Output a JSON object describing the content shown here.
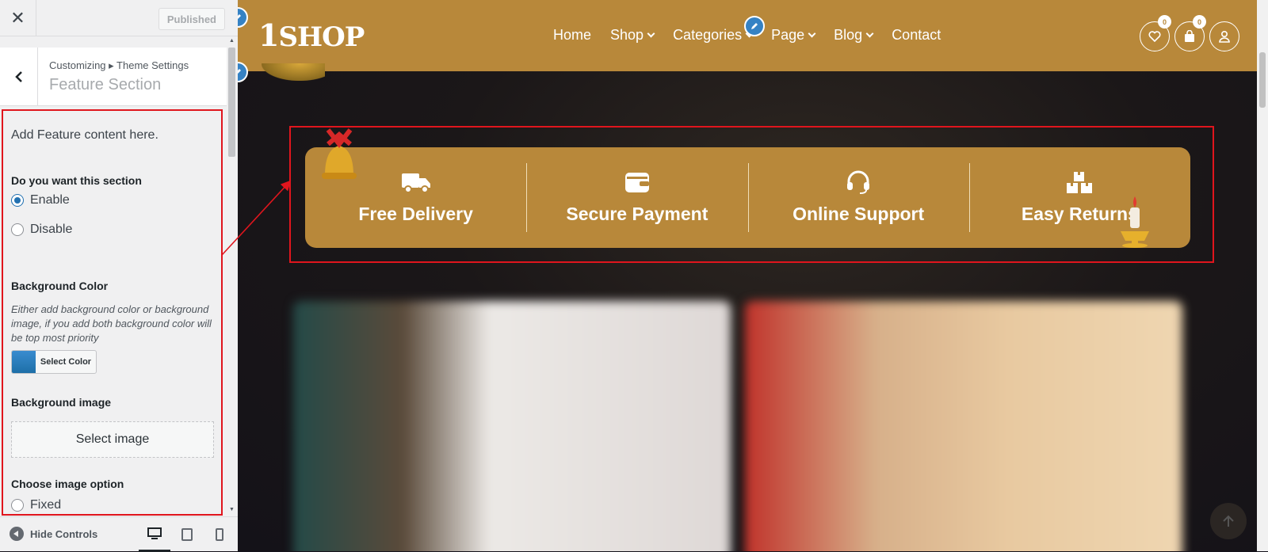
{
  "customizer": {
    "close_label": "✕",
    "publish_label": "Published",
    "breadcrumb": "Customizing ▸ Theme Settings",
    "section_title": "Feature Section",
    "description": "Add Feature content here.",
    "enable_section": {
      "title": "Do you want this section",
      "options": [
        "Enable",
        "Disable"
      ],
      "selected": "Enable"
    },
    "background_color": {
      "title": "Background Color",
      "description": "Either add background color or background image, if you add both background color will be top most priority",
      "button_label": "Select Color",
      "swatch_color": "#2a7fc2"
    },
    "background_image": {
      "title": "Background image",
      "button_label": "Select image"
    },
    "image_option": {
      "title": "Choose image option",
      "first_option": "Fixed"
    },
    "footer": {
      "hide_controls_label": "Hide Controls",
      "devices": [
        "desktop-icon",
        "tablet-icon",
        "mobile-icon"
      ],
      "active_device": "desktop"
    }
  },
  "preview": {
    "logo_text": "1SHOP",
    "logo_prefix": "1",
    "logo_suffix": "SHOP",
    "nav": [
      {
        "label": "Home",
        "dropdown": false
      },
      {
        "label": "Shop",
        "dropdown": true
      },
      {
        "label": "Categories",
        "dropdown": true
      },
      {
        "label": "Page",
        "dropdown": true
      },
      {
        "label": "Blog",
        "dropdown": true
      },
      {
        "label": "Contact",
        "dropdown": false
      }
    ],
    "wishlist_count": "0",
    "cart_count": "0",
    "features": [
      {
        "title": "Free Delivery",
        "icon": "truck-icon"
      },
      {
        "title": "Secure Payment",
        "icon": "wallet-icon"
      },
      {
        "title": "Online Support",
        "icon": "headset-icon"
      },
      {
        "title": "Easy Returns",
        "icon": "boxes-icon"
      }
    ],
    "colors": {
      "brand": "#b8883a",
      "highlight": "#e0151d",
      "edit_pen": "#3582c4"
    }
  }
}
